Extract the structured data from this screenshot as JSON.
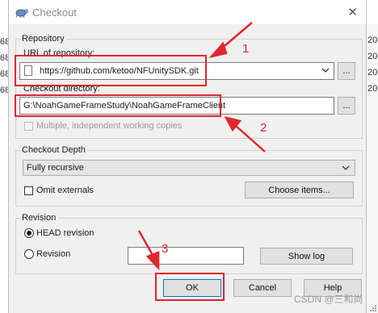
{
  "dialog": {
    "title": "Checkout",
    "close_icon": "close-icon"
  },
  "repository": {
    "group_label": "Repository",
    "url_label": "URL of repository:",
    "url_value": "https://github.com/ketoo/NFUnitySDK.git",
    "browse_label": "...",
    "checkout_dir_label": "Checkout directory:",
    "checkout_dir_value": "G:\\NoahGameFrameStudy\\NoahGameFrameClient",
    "browse_dir_label": "...",
    "multiple_wc_label": "Multiple, independent working copies"
  },
  "depth": {
    "group_label": "Checkout Depth",
    "selected": "Fully recursive",
    "omit_externals_label": "Omit externals",
    "choose_items_label": "Choose items..."
  },
  "revision": {
    "group_label": "Revision",
    "head_label": "HEAD revision",
    "revision_label": "Revision",
    "revision_value": "",
    "show_log_label": "Show log"
  },
  "buttons": {
    "ok": "OK",
    "cancel": "Cancel",
    "help": "Help"
  },
  "annotations": {
    "one": "1",
    "two": "2",
    "three": "3",
    "color": "#e0262b"
  },
  "background": {
    "left_digits": [
      "68",
      "68",
      "68",
      "68"
    ],
    "right_digits": [
      "20",
      "20",
      "20",
      "20"
    ]
  },
  "watermark": "CSDN @三和尚"
}
